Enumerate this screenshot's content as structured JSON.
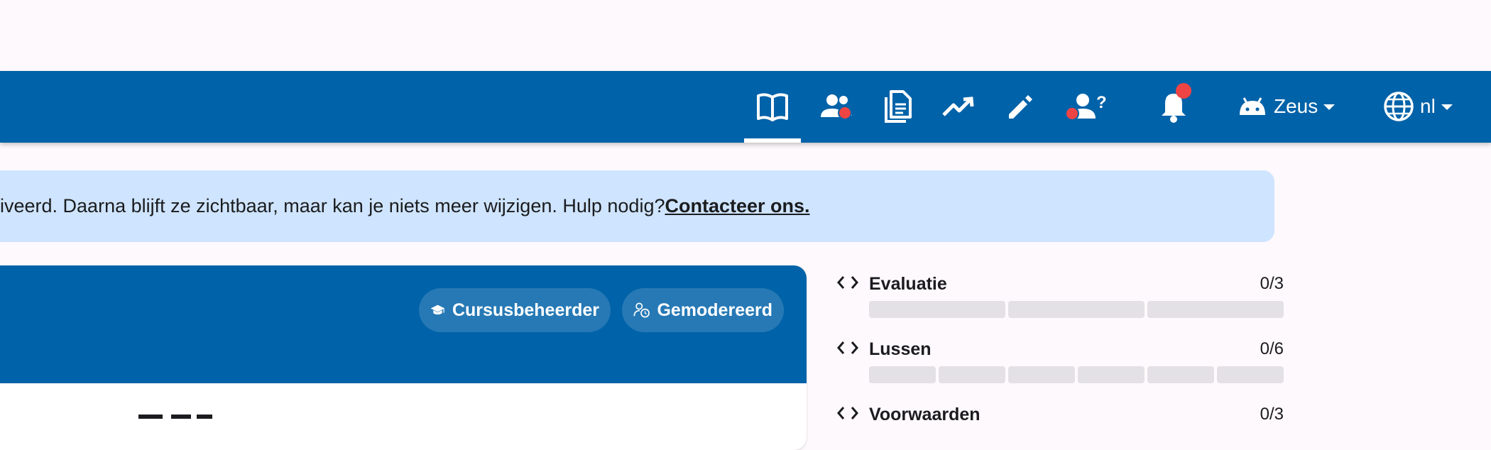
{
  "topbar": {
    "nav_icons": [
      {
        "name": "course-book-icon",
        "active": true
      },
      {
        "name": "users-icon",
        "badge": true
      },
      {
        "name": "submissions-icon"
      },
      {
        "name": "statistics-icon"
      },
      {
        "name": "edit-icon"
      },
      {
        "name": "questions-icon",
        "badge": true,
        "suffix": "?"
      }
    ],
    "notifications": {
      "name": "bell-icon",
      "badge": true
    },
    "user_menu": {
      "label": "Zeus",
      "icon": "android-icon"
    },
    "language_menu": {
      "label": "nl",
      "icon": "globe-icon"
    },
    "questions_suffix": "?"
  },
  "banner": {
    "text": "iveerd. Daarna blijft ze zichtbaar, maar kan je niets meer wijzigen. Hulp nodig? ",
    "link": "Contacteer ons."
  },
  "card": {
    "chips": [
      {
        "label": "Cursusbeheerder",
        "icon": "graduation-cap-icon"
      },
      {
        "label": "Gemodereerd",
        "icon": "user-clock-icon"
      }
    ]
  },
  "exercises": [
    {
      "name": "Evaluatie",
      "score": "0/3",
      "segments": 3,
      "icon": "code-icon"
    },
    {
      "name": "Lussen",
      "score": "0/6",
      "segments": 6,
      "icon": "code-icon"
    },
    {
      "name": "Voorwaarden",
      "score": "0/3",
      "segments": 3,
      "icon": "code-icon"
    }
  ],
  "colors": {
    "primary": "#0062a8",
    "banner_bg": "#cfe4ff",
    "badge": "#ef4444",
    "progress_empty": "#e4e1e6",
    "page_bg": "#fdf9fc"
  }
}
